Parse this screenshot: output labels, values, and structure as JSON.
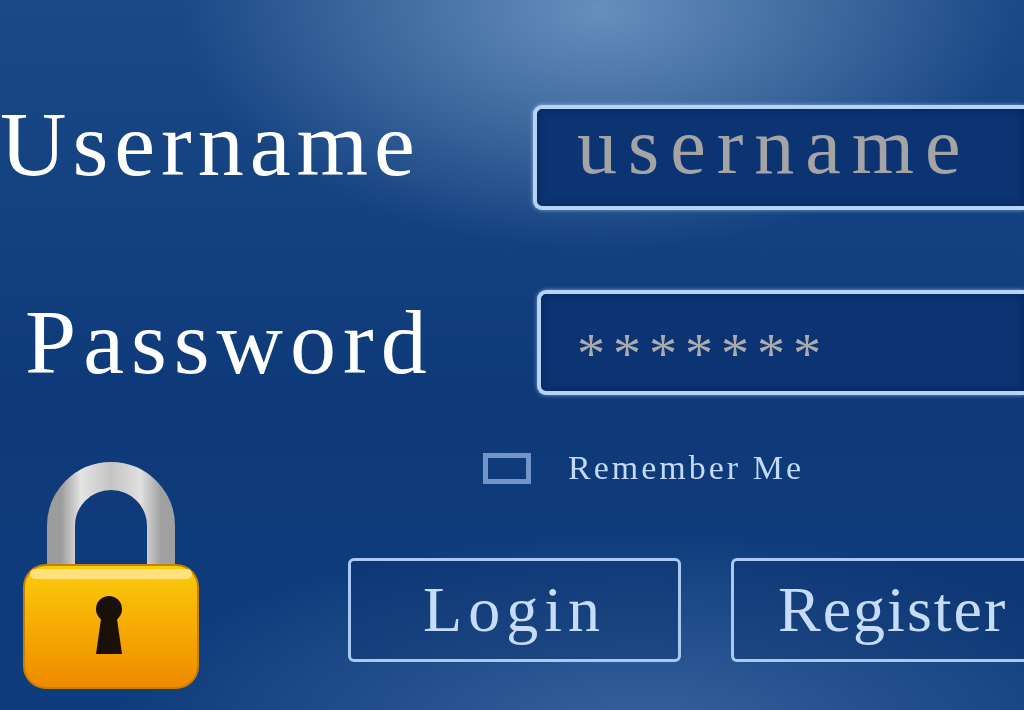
{
  "form": {
    "fields": [
      {
        "label": "Username",
        "placeholder": "username"
      },
      {
        "label": "Password",
        "value": "*******"
      }
    ],
    "remember_me": {
      "label": "Remember Me",
      "checked": false
    },
    "buttons": [
      "Login",
      "Register"
    ]
  }
}
